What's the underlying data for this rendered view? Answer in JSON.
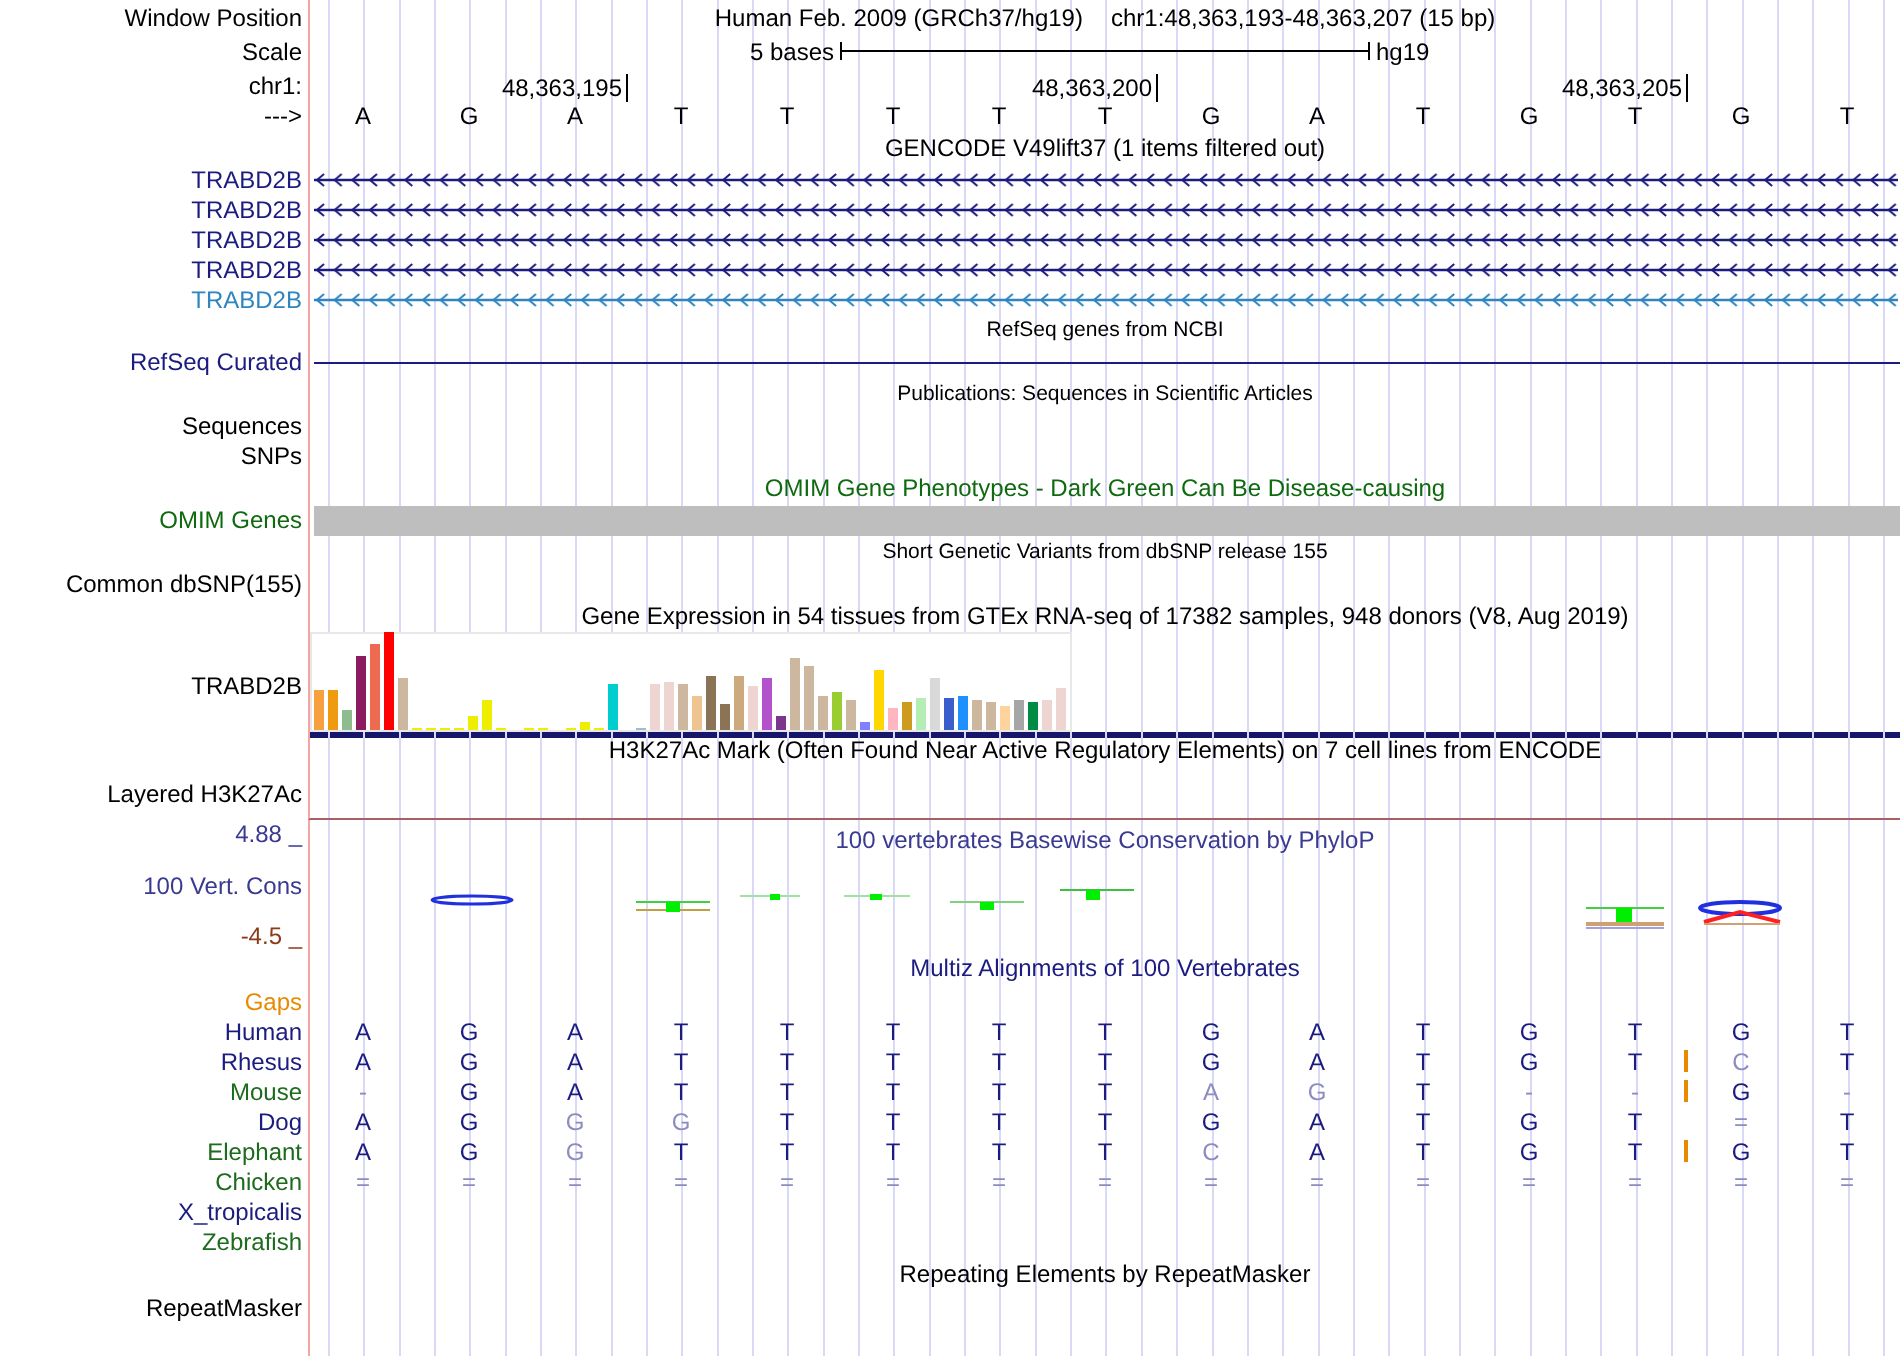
{
  "header": {
    "window_position": {
      "label": "Window Position",
      "assembly": "Human Feb. 2009 (GRCh37/hg19)",
      "range": "chr1:48,363,193-48,363,207 (15 bp)"
    },
    "scale": {
      "label": "Scale",
      "span": "5 bases",
      "assembly": "hg19"
    },
    "ruler": {
      "label": "chr1:",
      "ticks": [
        "48,363,195",
        "48,363,200",
        "48,363,205"
      ]
    },
    "sequence": {
      "label": "--->",
      "bases": [
        "A",
        "G",
        "A",
        "T",
        "T",
        "T",
        "T",
        "T",
        "G",
        "A",
        "T",
        "G",
        "T",
        "G",
        "T"
      ]
    }
  },
  "tracks": [
    {
      "kind": "title",
      "text": "GENCODE V49lift37 (1 items filtered out)",
      "color": "#000000",
      "small": false
    },
    {
      "kind": "gene",
      "label": "TRABD2B",
      "color": "#1c1c80"
    },
    {
      "kind": "gene",
      "label": "TRABD2B",
      "color": "#1c1c80"
    },
    {
      "kind": "gene",
      "label": "TRABD2B",
      "color": "#1c1c80"
    },
    {
      "kind": "gene",
      "label": "TRABD2B",
      "color": "#1c1c80"
    },
    {
      "kind": "gene",
      "label": "TRABD2B",
      "color": "#2f85c0"
    },
    {
      "kind": "title",
      "text": "RefSeq genes from NCBI",
      "color": "#000000",
      "small": true
    },
    {
      "kind": "line",
      "label": "RefSeq Curated",
      "color": "#1c1c80"
    },
    {
      "kind": "title",
      "text": "Publications: Sequences in Scientific Articles",
      "color": "#000000",
      "small": true
    },
    {
      "kind": "label",
      "label": "Sequences",
      "color": "#000000"
    },
    {
      "kind": "label",
      "label": "SNPs",
      "color": "#000000"
    },
    {
      "kind": "title",
      "text": "OMIM Gene Phenotypes - Dark Green Can Be Disease-causing",
      "color": "#0f6a0f",
      "small": false
    },
    {
      "kind": "bar",
      "label": "OMIM Genes",
      "color": "#0f6a0f"
    },
    {
      "kind": "title",
      "text": "Short Genetic Variants from dbSNP release 155",
      "color": "#000000",
      "small": true
    },
    {
      "kind": "label",
      "label": "Common dbSNP(155)",
      "color": "#000000"
    },
    {
      "kind": "title",
      "text": "Gene Expression in 54 tissues from GTEx RNA-seq of 17382 samples, 948 donors (V8, Aug 2019)",
      "color": "#000000",
      "small": false
    },
    {
      "kind": "expression",
      "label": "TRABD2B",
      "color": "#000000"
    },
    {
      "kind": "title",
      "text": "H3K27Ac Mark (Often Found Near Active Regulatory Elements) on 7 cell lines from ENCODE",
      "color": "#000000",
      "small": false
    },
    {
      "kind": "signal",
      "label": "Layered H3K27Ac",
      "color": "#000000"
    },
    {
      "kind": "conservation",
      "title": {
        "text": "100 vertebrates Basewise Conservation by PhyloP",
        "color": "#3a3a90"
      },
      "labels": [
        {
          "text": "4.88 _",
          "color": "#3a3a90"
        },
        {
          "text": "100 Vert. Cons",
          "color": "#3a3a90"
        },
        {
          "text": "-4.5 _",
          "color": "#8b3a1a"
        }
      ]
    },
    {
      "kind": "title",
      "text": "Multiz Alignments of 100 Vertebrates",
      "color": "#1c1c80",
      "small": false
    },
    {
      "kind": "label",
      "label": "Gaps",
      "color": "#e88a00"
    },
    {
      "kind": "species",
      "label": "Human",
      "color": "#1c1c80",
      "insertion": false,
      "bases": [
        {
          "text": "A",
          "faded": false
        },
        {
          "text": "G",
          "faded": false
        },
        {
          "text": "A",
          "faded": false
        },
        {
          "text": "T",
          "faded": false
        },
        {
          "text": "T",
          "faded": false
        },
        {
          "text": "T",
          "faded": false
        },
        {
          "text": "T",
          "faded": false
        },
        {
          "text": "T",
          "faded": false
        },
        {
          "text": "G",
          "faded": false
        },
        {
          "text": "A",
          "faded": false
        },
        {
          "text": "T",
          "faded": false
        },
        {
          "text": "G",
          "faded": false
        },
        {
          "text": "T",
          "faded": false
        },
        {
          "text": "G",
          "faded": false
        },
        {
          "text": "T",
          "faded": false
        }
      ]
    },
    {
      "kind": "species",
      "label": "Rhesus",
      "color": "#1c1c80",
      "insertion": true,
      "bases": [
        {
          "text": "A",
          "faded": false
        },
        {
          "text": "G",
          "faded": false
        },
        {
          "text": "A",
          "faded": false
        },
        {
          "text": "T",
          "faded": false
        },
        {
          "text": "T",
          "faded": false
        },
        {
          "text": "T",
          "faded": false
        },
        {
          "text": "T",
          "faded": false
        },
        {
          "text": "T",
          "faded": false
        },
        {
          "text": "G",
          "faded": false
        },
        {
          "text": "A",
          "faded": false
        },
        {
          "text": "T",
          "faded": false
        },
        {
          "text": "G",
          "faded": false
        },
        {
          "text": "T",
          "faded": false
        },
        {
          "text": "C",
          "faded": true
        },
        {
          "text": "T",
          "faded": false
        }
      ]
    },
    {
      "kind": "species",
      "label": "Mouse",
      "color": "#1d6b1d",
      "insertion": true,
      "bases": [
        {
          "text": "-",
          "faded": true
        },
        {
          "text": "G",
          "faded": false
        },
        {
          "text": "A",
          "faded": false
        },
        {
          "text": "T",
          "faded": false
        },
        {
          "text": "T",
          "faded": false
        },
        {
          "text": "T",
          "faded": false
        },
        {
          "text": "T",
          "faded": false
        },
        {
          "text": "T",
          "faded": false
        },
        {
          "text": "A",
          "faded": true
        },
        {
          "text": "G",
          "faded": true
        },
        {
          "text": "T",
          "faded": false
        },
        {
          "text": "-",
          "faded": true
        },
        {
          "text": "-",
          "faded": true
        },
        {
          "text": "G",
          "faded": false
        },
        {
          "text": "-",
          "faded": true
        }
      ]
    },
    {
      "kind": "species",
      "label": "Dog",
      "color": "#1c1c80",
      "insertion": false,
      "bases": [
        {
          "text": "A",
          "faded": false
        },
        {
          "text": "G",
          "faded": false
        },
        {
          "text": "G",
          "faded": true
        },
        {
          "text": "G",
          "faded": true
        },
        {
          "text": "T",
          "faded": false
        },
        {
          "text": "T",
          "faded": false
        },
        {
          "text": "T",
          "faded": false
        },
        {
          "text": "T",
          "faded": false
        },
        {
          "text": "G",
          "faded": false
        },
        {
          "text": "A",
          "faded": false
        },
        {
          "text": "T",
          "faded": false
        },
        {
          "text": "G",
          "faded": false
        },
        {
          "text": "T",
          "faded": false
        },
        {
          "text": "=",
          "faded": true
        },
        {
          "text": "T",
          "faded": false
        }
      ]
    },
    {
      "kind": "species",
      "label": "Elephant",
      "color": "#1d6b1d",
      "insertion": true,
      "bases": [
        {
          "text": "A",
          "faded": false
        },
        {
          "text": "G",
          "faded": false
        },
        {
          "text": "G",
          "faded": true
        },
        {
          "text": "T",
          "faded": false
        },
        {
          "text": "T",
          "faded": false
        },
        {
          "text": "T",
          "faded": false
        },
        {
          "text": "T",
          "faded": false
        },
        {
          "text": "T",
          "faded": false
        },
        {
          "text": "C",
          "faded": true
        },
        {
          "text": "A",
          "faded": false
        },
        {
          "text": "T",
          "faded": false
        },
        {
          "text": "G",
          "faded": false
        },
        {
          "text": "T",
          "faded": false
        },
        {
          "text": "G",
          "faded": false
        },
        {
          "text": "T",
          "faded": false
        }
      ]
    },
    {
      "kind": "species",
      "label": "Chicken",
      "color": "#1d6b1d",
      "insertion": false,
      "bases": [
        {
          "text": "=",
          "faded": true
        },
        {
          "text": "=",
          "faded": true
        },
        {
          "text": "=",
          "faded": true
        },
        {
          "text": "=",
          "faded": true
        },
        {
          "text": "=",
          "faded": true
        },
        {
          "text": "=",
          "faded": true
        },
        {
          "text": "=",
          "faded": true
        },
        {
          "text": "=",
          "faded": true
        },
        {
          "text": "=",
          "faded": true
        },
        {
          "text": "=",
          "faded": true
        },
        {
          "text": "=",
          "faded": true
        },
        {
          "text": "=",
          "faded": true
        },
        {
          "text": "=",
          "faded": true
        },
        {
          "text": "=",
          "faded": true
        },
        {
          "text": "=",
          "faded": true
        }
      ]
    },
    {
      "kind": "species",
      "label": "X_tropicalis",
      "color": "#1c1c80",
      "insertion": false
    },
    {
      "kind": "species",
      "label": "Zebrafish",
      "color": "#1d6b1d",
      "insertion": false
    },
    {
      "kind": "title",
      "text": "Repeating Elements by RepeatMasker",
      "color": "#000000",
      "small": false
    },
    {
      "kind": "label",
      "label": "RepeatMasker",
      "color": "#000000"
    }
  ]
}
